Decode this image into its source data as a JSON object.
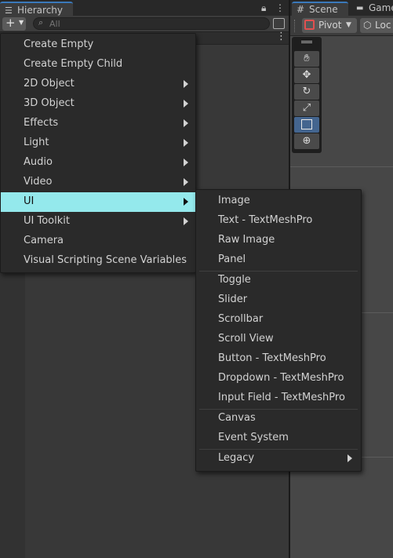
{
  "hierarchy": {
    "tab_title": "Hierarchy",
    "search_placeholder": "All"
  },
  "scene_panel": {
    "tab_scene": "Scene",
    "tab_game": "Game",
    "pivot_label": "Pivot",
    "local_label": "Loc"
  },
  "menu": {
    "items": [
      {
        "label": "Create Empty",
        "submenu": false
      },
      {
        "label": "Create Empty Child",
        "submenu": false
      },
      {
        "label": "2D Object",
        "submenu": true
      },
      {
        "label": "3D Object",
        "submenu": true
      },
      {
        "label": "Effects",
        "submenu": true
      },
      {
        "label": "Light",
        "submenu": true
      },
      {
        "label": "Audio",
        "submenu": true
      },
      {
        "label": "Video",
        "submenu": true
      },
      {
        "label": "UI",
        "submenu": true,
        "highlighted": true
      },
      {
        "label": "UI Toolkit",
        "submenu": true
      },
      {
        "label": "Camera",
        "submenu": false
      },
      {
        "label": "Visual Scripting Scene Variables",
        "submenu": false
      }
    ]
  },
  "ui_submenu": {
    "items": [
      {
        "label": "Image"
      },
      {
        "label": "Text - TextMeshPro"
      },
      {
        "label": "Raw Image"
      },
      {
        "label": "Panel"
      },
      {
        "label": "Toggle"
      },
      {
        "label": "Slider"
      },
      {
        "label": "Scrollbar"
      },
      {
        "label": "Scroll View"
      },
      {
        "label": "Button - TextMeshPro"
      },
      {
        "label": "Dropdown - TextMeshPro"
      },
      {
        "label": "Input Field - TextMeshPro"
      },
      {
        "label": "Canvas"
      },
      {
        "label": "Event System"
      },
      {
        "label": "Legacy",
        "submenu": true
      }
    ]
  },
  "colors": {
    "highlight": "#94e9ec",
    "menu_bg": "#2a2a2a",
    "panel_bg": "#383838",
    "active_tab_accent": "#3a79bb"
  }
}
